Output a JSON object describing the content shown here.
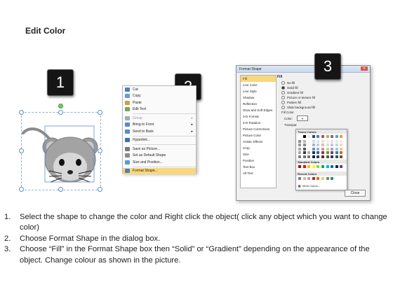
{
  "title": "Edit Color",
  "badges": [
    "1",
    "2",
    "3"
  ],
  "context_menu": {
    "items": [
      {
        "label": "Cut",
        "icon": "scissors-icon",
        "state": "normal"
      },
      {
        "label": "Copy",
        "icon": "copy-icon",
        "state": "normal"
      },
      {
        "label": "Paste",
        "icon": "paste-icon",
        "state": "normal"
      },
      {
        "label": "Edit Text",
        "icon": "edit-text-icon",
        "state": "normal"
      },
      {
        "label": "Group",
        "icon": "group-icon",
        "state": "disabled",
        "submenu": true
      },
      {
        "label": "Bring to Front",
        "icon": "bring-front-icon",
        "state": "normal",
        "submenu": true
      },
      {
        "label": "Send to Back",
        "icon": "send-back-icon",
        "state": "normal",
        "submenu": true
      },
      {
        "label": "Hyperlink...",
        "icon": "hyperlink-icon",
        "state": "normal"
      },
      {
        "label": "Save as Picture...",
        "icon": "save-picture-icon",
        "state": "normal"
      },
      {
        "label": "Set as Default Shape",
        "icon": "default-shape-icon",
        "state": "normal"
      },
      {
        "label": "Size and Position...",
        "icon": "size-position-icon",
        "state": "normal"
      },
      {
        "label": "Format Shape...",
        "icon": "format-shape-icon",
        "state": "highlighted"
      }
    ]
  },
  "dialog": {
    "title": "Format Shape",
    "close_label": "Close",
    "categories": [
      "Fill",
      "Line Color",
      "Line Style",
      "Shadow",
      "Reflection",
      "Glow and Soft Edges",
      "3-D Format",
      "3-D Rotation",
      "Picture Corrections",
      "Picture Color",
      "Artistic Effects",
      "Crop",
      "Size",
      "Position",
      "Text Box",
      "Alt Text"
    ],
    "selected_category": "Fill",
    "fill_heading": "Fill",
    "fill_options": [
      {
        "label": "No fill",
        "selected": false
      },
      {
        "label": "Solid fill",
        "selected": true
      },
      {
        "label": "Gradient fill",
        "selected": false
      },
      {
        "label": "Picture or texture fill",
        "selected": false
      },
      {
        "label": "Pattern fill",
        "selected": false
      },
      {
        "label": "Slide background fill",
        "selected": false
      }
    ],
    "fill_color_heading": "Fill Color",
    "color_label": "Color:",
    "transparency_label": "Transpar",
    "palette": {
      "theme_heading": "Theme Colors",
      "standard_heading": "Standard Colors",
      "recent_heading": "Recent Colors",
      "more_colors": "More Colors...",
      "theme_top": [
        "#ffffff",
        "#000000",
        "#eeece1",
        "#1f497d",
        "#4f81bd",
        "#c0504d",
        "#9bbb59",
        "#8064a2",
        "#4bacc6",
        "#f79646"
      ],
      "standard": [
        "#c00000",
        "#ff0000",
        "#ffc000",
        "#ffff00",
        "#92d050",
        "#00b050",
        "#00b0f0",
        "#0070c0",
        "#002060",
        "#7030a0"
      ],
      "recent": [
        "#7f7f7f",
        "#bfbfbf",
        "#d99694",
        "#953735",
        "#e46c0a",
        "#c3d69b",
        "#77933c",
        "#31859c"
      ]
    }
  },
  "steps": [
    {
      "num": "1.",
      "text": "Select the shape to change the color and Right click the object( click any object which you want to change color)"
    },
    {
      "num": "2.",
      "text": "Choose Format Shape in the dialog box."
    },
    {
      "num": "3.",
      "text": "Choose “Fill” in the Format Shape box then “Solid” or “Gradient” depending on the appearance of the object. Change colour as shown in the picture."
    }
  ]
}
